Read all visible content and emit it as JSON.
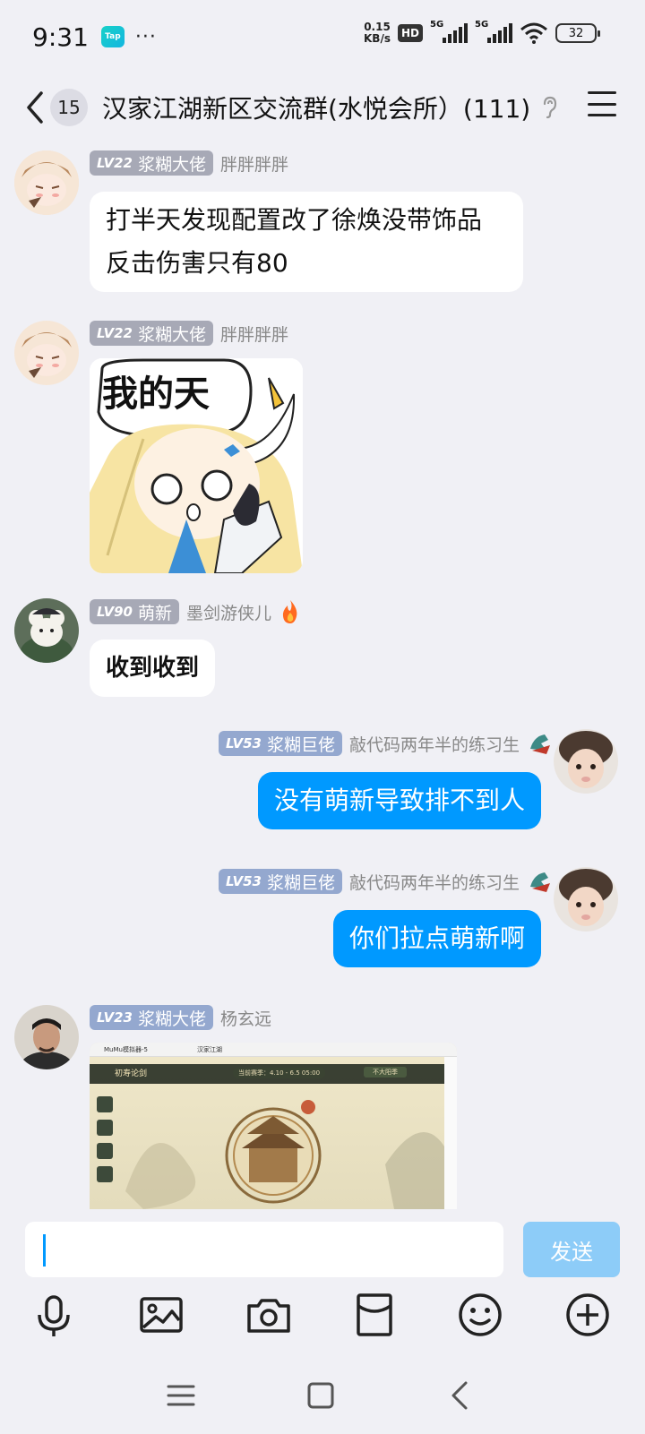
{
  "status_bar": {
    "time": "9:31",
    "app_badge": "Tap",
    "overflow": "···",
    "net_speed_value": "0.15",
    "net_speed_unit": "KB/s",
    "hd_label": "HD",
    "sim1_label": "5G",
    "sim2_label": "5G",
    "battery": "32"
  },
  "header": {
    "unread_count": "15",
    "title": "汉家江湖新区交流群(水悦会所）(111)"
  },
  "messages": [
    {
      "level": "LV22",
      "title": "浆糊大佬",
      "nickname": "胖胖胖胖",
      "text": "打半天发现配置改了徐焕没带饰品\n反击伤害只有80"
    },
    {
      "level": "LV22",
      "title": "浆糊大佬",
      "nickname": "胖胖胖胖",
      "sticker_text": "我的天"
    },
    {
      "level": "LV90",
      "title": "萌新",
      "nickname": "墨剑游侠儿",
      "text": "收到收到"
    },
    {
      "level": "LV53",
      "title": "浆糊巨佬",
      "nickname": "敲代码两年半的练习生",
      "text": "没有萌新导致排不到人"
    },
    {
      "level": "LV53",
      "title": "浆糊巨佬",
      "nickname": "敲代码两年半的练习生",
      "text": "你们拉点萌新啊"
    },
    {
      "level": "LV23",
      "title": "浆糊大佬",
      "nickname": "杨玄远",
      "image": {
        "window_title": "MuMu模拟器-5",
        "tab_title": "汉家江湖",
        "screen_title": "初寿论剑",
        "season_text": "当前赛季：4.10 - 6.5 05:00",
        "dropdown": "不大阳季"
      }
    }
  ],
  "input": {
    "send_label": "发送"
  },
  "colors": {
    "accent": "#0099ff",
    "send_disabled": "#8dccf8",
    "tag_blue": "#94a8cf",
    "tag_grey": "#a7a9b6"
  }
}
